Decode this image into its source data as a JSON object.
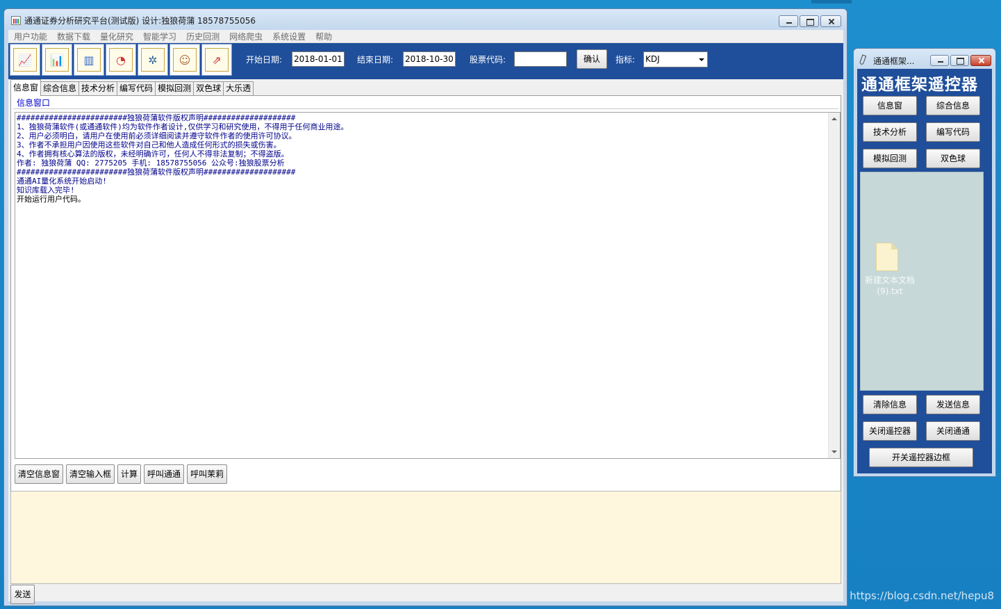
{
  "main_window": {
    "title": "通通证券分析研究平台(测试版) 设计:独狼荷蒲 18578755056",
    "menu": [
      "用户功能",
      "数据下载",
      "量化研究",
      "智能学习",
      "历史回测",
      "网络爬虫",
      "系统设置",
      "帮助"
    ],
    "toolbar": {
      "icons": [
        "line-chart-icon",
        "bar-chart-icon",
        "column-chart-icon",
        "pie-chart-icon",
        "network-icon",
        "user-icon",
        "stock-chart-icon"
      ],
      "start_date_label": "开始日期:",
      "start_date_value": "2018-01-01",
      "end_date_label": "结束日期:",
      "end_date_value": "2018-10-30",
      "stock_code_label": "股票代码:",
      "stock_code_value": "",
      "confirm_label": "确认",
      "indicator_label": "指标:",
      "indicator_value": "KDJ"
    },
    "tabs": [
      "信息窗",
      "综合信息",
      "技术分析",
      "编写代码",
      "模拟回测",
      "双色球",
      "大乐透"
    ],
    "panel_caption": "信息窗口",
    "log_lines": [
      {
        "text": "########################独狼荷蒲软件版权声明####################",
        "color": "blue"
      },
      {
        "text": "1、独狼荷蒲软件(或通通软件)均为软件作者设计,仅供学习和研究使用，不得用于任何商业用途。",
        "color": "blue"
      },
      {
        "text": "2、用户必须明白，请用户在使用前必须详细阅读并遵守软件作者的使用许可协议。",
        "color": "blue"
      },
      {
        "text": "3、作者不承担用户因使用这些软件对自己和他人造成任何形式的损失或伤害。",
        "color": "blue"
      },
      {
        "text": "4、作者拥有核心算法的版权，未经明确许可，任何人不得非法复制；不得盗版。",
        "color": "blue"
      },
      {
        "text": "作者: 独狼荷蒲 QQ: 2775205 手机: 18578755056 公众号:独狼股票分析",
        "color": "blue"
      },
      {
        "text": "########################独狼荷蒲软件版权声明####################",
        "color": "blue"
      },
      {
        "text": "通通AI量化系统开始启动!",
        "color": "blue"
      },
      {
        "text": "知识库载入完毕!",
        "color": "blue"
      },
      {
        "text": "开始运行用户代码。",
        "color": "black"
      }
    ],
    "actions": [
      "清空信息窗",
      "清空输入框",
      "计算",
      "呼叫通通",
      "呼叫茉莉"
    ],
    "input_value": "",
    "send_label": "发送"
  },
  "remote_window": {
    "title": "通通框架...",
    "heading": "通通框架遥控器",
    "buttons_top": [
      "信息窗",
      "综合信息",
      "技术分析",
      "编写代码",
      "模拟回测",
      "双色球"
    ],
    "desktop_file_label": "新建文本文档 (9).txt",
    "buttons_bottom": [
      "清除信息",
      "发送信息",
      "关闭遥控器",
      "关闭通通"
    ],
    "toggle_border_label": "开关遥控器边框"
  },
  "watermark": "https://blog.csdn.net/hepu8"
}
